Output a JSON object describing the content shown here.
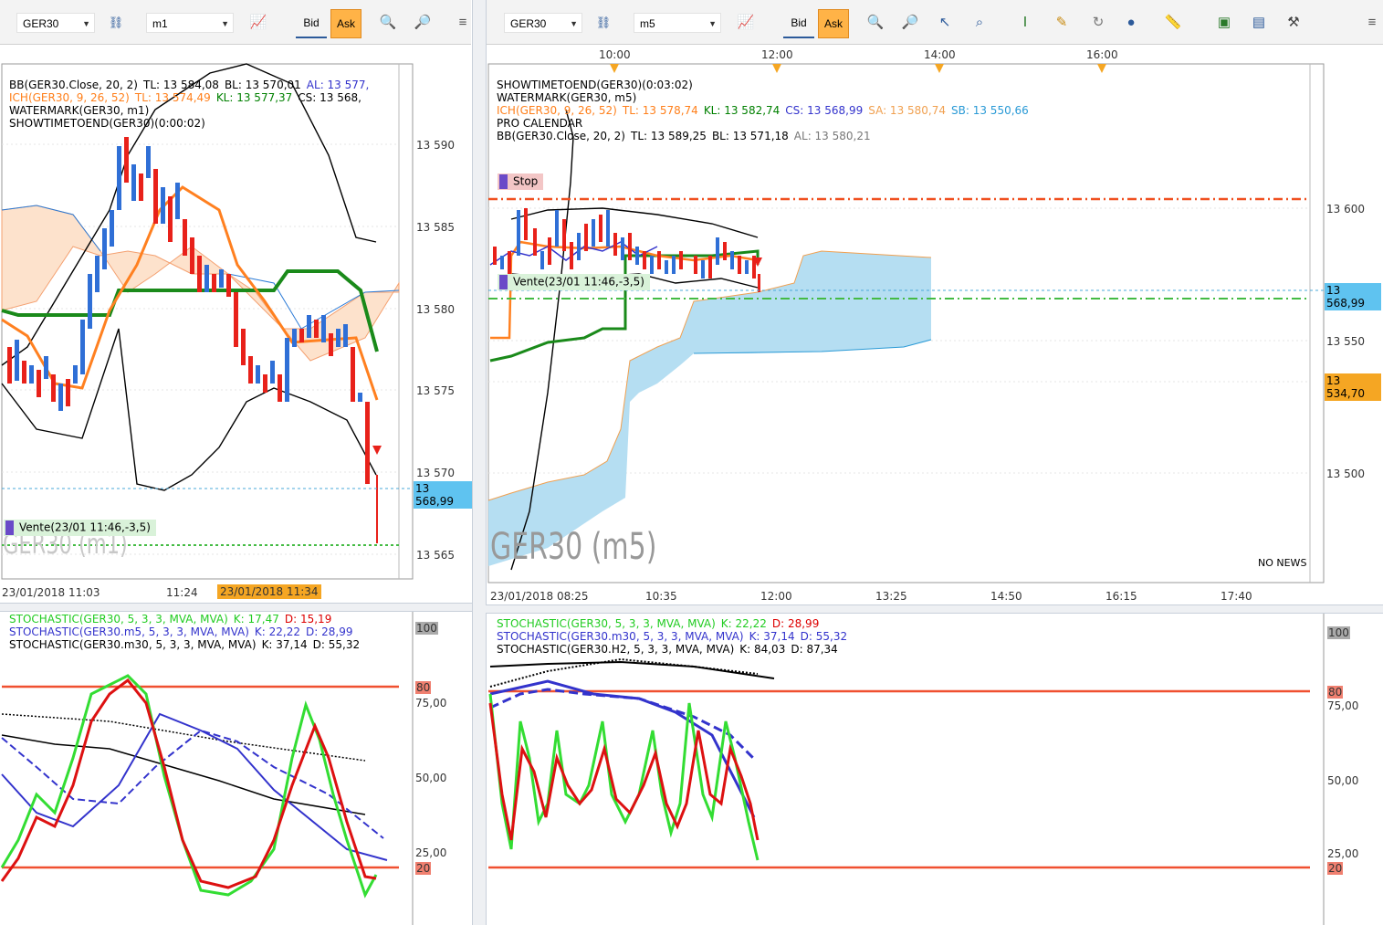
{
  "left_toolbar": {
    "symbol": "GER30",
    "timeframe": "m1",
    "bid_label": "Bid",
    "ask_label": "Ask"
  },
  "right_toolbar": {
    "symbol": "GER30",
    "timeframe": "m5",
    "bid_label": "Bid",
    "ask_label": "Ask"
  },
  "left_chart": {
    "legend": [
      {
        "parts": [
          {
            "text": "BB(GER30.Close, 20, 2)",
            "color": "#000000"
          },
          {
            "text": "TL: 13 584,08",
            "color": "#000000"
          },
          {
            "text": "BL: 13 570,01",
            "color": "#000000"
          },
          {
            "text": "AL: 13 577,",
            "color": "#3333cc"
          }
        ]
      },
      {
        "parts": [
          {
            "text": "ICH(GER30, 9, 26, 52)",
            "color": "#ff7f1a"
          },
          {
            "text": "TL: 13 574,49",
            "color": "#ff7f1a"
          },
          {
            "text": "KL: 13 577,37",
            "color": "#008000"
          },
          {
            "text": "CS: 13 568,",
            "color": "#000000"
          }
        ]
      },
      {
        "parts": [
          {
            "text": "WATERMARK(GER30, m1)",
            "color": "#000000"
          }
        ]
      },
      {
        "parts": [
          {
            "text": "SHOWTIMETOEND(GER30)(0:00:02)",
            "color": "#000000"
          }
        ]
      }
    ],
    "y_ticks": [
      "13 590",
      "13 585",
      "13 580",
      "13 575",
      "13 570",
      "13 565"
    ],
    "current_price": "13 568,99",
    "order_label": "Vente(23/01 11:46,-3,5)",
    "watermark": "GER30 (m1)",
    "time_labels": [
      "23/01/2018 11:03",
      "11:24"
    ],
    "time_highlight": "23/01/2018 11:34"
  },
  "right_chart": {
    "legend": [
      {
        "parts": [
          {
            "text": "SHOWTIMETOEND(GER30)(0:03:02)",
            "color": "#000000"
          }
        ]
      },
      {
        "parts": [
          {
            "text": "WATERMARK(GER30, m5)",
            "color": "#000000"
          }
        ]
      },
      {
        "parts": [
          {
            "text": "ICH(GER30, 9, 26, 52)",
            "color": "#ff7f1a"
          },
          {
            "text": "TL: 13 578,74",
            "color": "#ff7f1a"
          },
          {
            "text": "KL: 13 582,74",
            "color": "#008000"
          },
          {
            "text": "CS: 13 568,99",
            "color": "#3333cc"
          },
          {
            "text": "SA: 13 580,74",
            "color": "#f0a050"
          },
          {
            "text": "SB: 13 550,66",
            "color": "#2a9ad6"
          }
        ]
      },
      {
        "parts": [
          {
            "text": "PRO CALENDAR",
            "color": "#000000"
          }
        ]
      },
      {
        "parts": [
          {
            "text": "BB(GER30.Close, 20, 2)",
            "color": "#000000"
          },
          {
            "text": "TL: 13 589,25",
            "color": "#000000"
          },
          {
            "text": "BL: 13 571,18",
            "color": "#000000"
          },
          {
            "text": "AL: 13 580,21",
            "color": "#777777"
          }
        ]
      }
    ],
    "stop_label": "Stop",
    "order_label": "Vente(23/01 11:46,-3,5)",
    "y_ticks": [
      "13 600",
      "13 550",
      "13 500"
    ],
    "current_price": "13 568,99",
    "stop_price": "13 534,70",
    "watermark": "GER30 (m5)",
    "no_news": "NO NEWS",
    "top_times": [
      "10:00",
      "12:00",
      "14:00",
      "16:00"
    ],
    "bottom_times": [
      "23/01/2018 08:25",
      "10:35",
      "12:00",
      "13:25",
      "14:50",
      "16:15",
      "17:40"
    ]
  },
  "left_stoch": {
    "legend": [
      {
        "parts": [
          {
            "text": "STOCHASTIC(GER30, 5, 3, 3, MVA, MVA)",
            "color": "#22cc22"
          },
          {
            "text": "K: 17,47",
            "color": "#22cc22"
          },
          {
            "text": "D: 15,19",
            "color": "#dd0000"
          }
        ]
      },
      {
        "parts": [
          {
            "text": "STOCHASTIC(GER30.m5, 5, 3, 3, MVA, MVA)",
            "color": "#3333cc"
          },
          {
            "text": "K: 22,22",
            "color": "#3333cc"
          },
          {
            "text": "D: 28,99",
            "color": "#3333cc"
          }
        ]
      },
      {
        "parts": [
          {
            "text": "STOCHASTIC(GER30.m30, 5, 3, 3, MVA, MVA)",
            "color": "#000000"
          },
          {
            "text": "K: 37,14",
            "color": "#000000"
          },
          {
            "text": "D: 55,32",
            "color": "#000000"
          }
        ]
      }
    ],
    "y_ticks": [
      "100",
      "80",
      "75,00",
      "50,00",
      "25,00",
      "20"
    ]
  },
  "right_stoch": {
    "legend": [
      {
        "parts": [
          {
            "text": "STOCHASTIC(GER30, 5, 3, 3, MVA, MVA)",
            "color": "#22cc22"
          },
          {
            "text": "K: 22,22",
            "color": "#22cc22"
          },
          {
            "text": "D: 28,99",
            "color": "#dd0000"
          }
        ]
      },
      {
        "parts": [
          {
            "text": "STOCHASTIC(GER30.m30, 5, 3, 3, MVA, MVA)",
            "color": "#3333cc"
          },
          {
            "text": "K: 37,14",
            "color": "#3333cc"
          },
          {
            "text": "D: 55,32",
            "color": "#3333cc"
          }
        ]
      },
      {
        "parts": [
          {
            "text": "STOCHASTIC(GER30.H2, 5, 3, 3, MVA, MVA)",
            "color": "#000000"
          },
          {
            "text": "K: 84,03",
            "color": "#000000"
          },
          {
            "text": "D: 87,34",
            "color": "#000000"
          }
        ]
      }
    ],
    "y_ticks": [
      "100",
      "80",
      "75,00",
      "50,00",
      "25,00",
      "20"
    ]
  },
  "colors": {
    "bull": "#2f6fd6",
    "bear": "#e8211a",
    "kijun": "#1a8a1a",
    "tenkan": "#ff8020",
    "cloud_left": "#fde2cc",
    "cloud_right": "#b5def2"
  }
}
